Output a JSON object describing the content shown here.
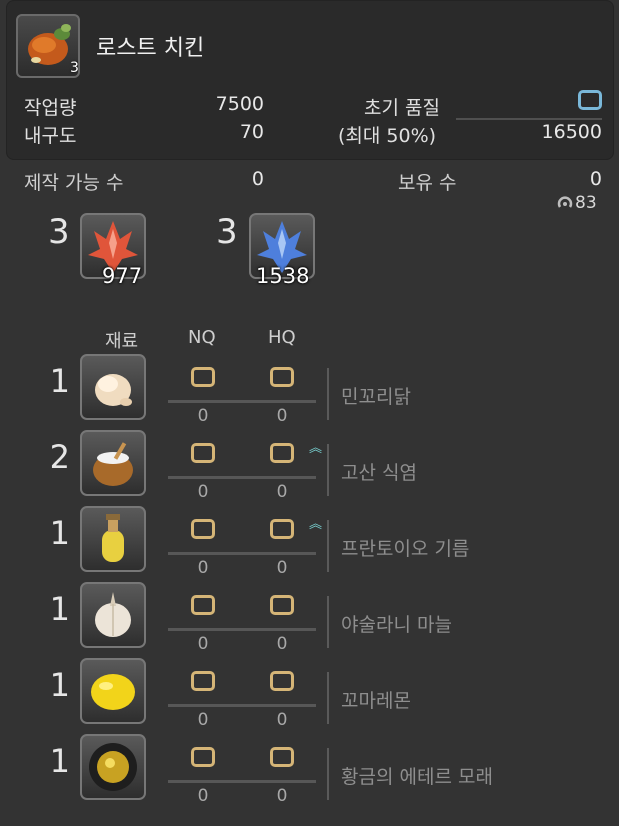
{
  "recipe": {
    "name": "로스트 치킨",
    "yield": "3"
  },
  "stats": {
    "workload_label": "작업량",
    "workload_value": "7500",
    "durability_label": "내구도",
    "durability_value": "70",
    "initial_quality_label": "초기 품질",
    "max_label": "(최대 50%)",
    "quality_max_value": "16500"
  },
  "summary": {
    "craftable_label": "제작 가능 수",
    "craftable_value": "0",
    "owned_label": "보유 수",
    "owned_value": "0",
    "ring_count": "83"
  },
  "crystals": [
    {
      "count": "3",
      "have": "977",
      "color": "#e0553a"
    },
    {
      "count": "3",
      "have": "1538",
      "color": "#4e7fdc"
    }
  ],
  "headers": {
    "material": "재료",
    "nq": "NQ",
    "hq": "HQ"
  },
  "materials": [
    {
      "count": "1",
      "name": "민꼬리닭",
      "nq": "0",
      "hq": "0",
      "icon": "chicken-icon",
      "chevron": false
    },
    {
      "count": "2",
      "name": "고산 식염",
      "nq": "0",
      "hq": "0",
      "icon": "salt-pot-icon",
      "chevron": true
    },
    {
      "count": "1",
      "name": "프란토이오 기름",
      "nq": "0",
      "hq": "0",
      "icon": "oil-bottle-icon",
      "chevron": true
    },
    {
      "count": "1",
      "name": "야술라니 마늘",
      "nq": "0",
      "hq": "0",
      "icon": "garlic-icon",
      "chevron": false
    },
    {
      "count": "1",
      "name": "꼬마레몬",
      "nq": "0",
      "hq": "0",
      "icon": "lemon-icon",
      "chevron": false
    },
    {
      "count": "1",
      "name": "황금의 에테르 모래",
      "nq": "0",
      "hq": "0",
      "icon": "aether-sand-icon",
      "chevron": false
    }
  ],
  "colors": {
    "quality_box": "#d5b577",
    "initial_quality_box": "#7ab8d9",
    "hq_chevron": "#7ad4d4"
  }
}
